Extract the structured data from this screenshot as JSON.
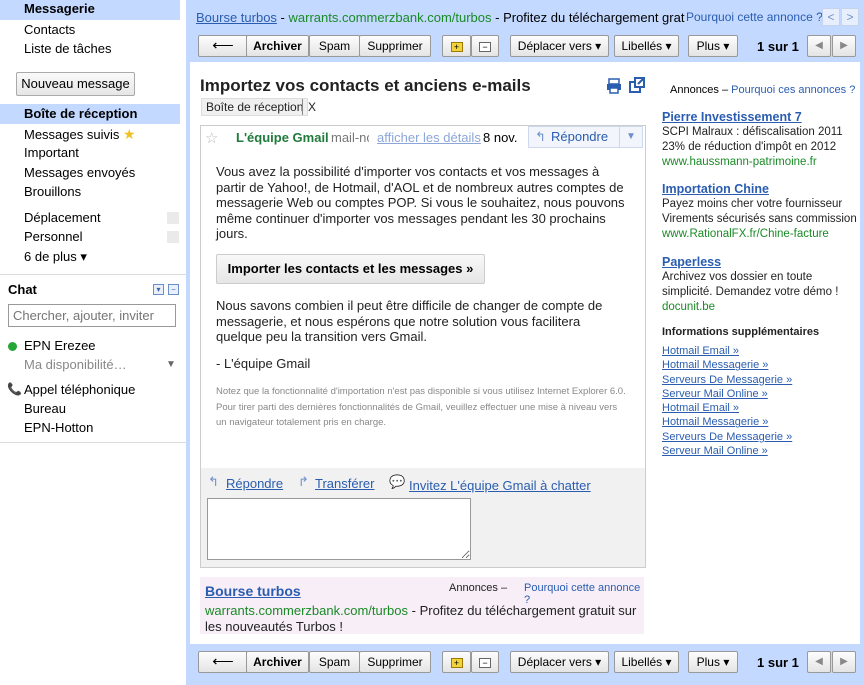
{
  "nav": {
    "mail": "Messagerie",
    "contacts": "Contacts",
    "tasks": "Liste de tâches",
    "compose": "Nouveau message",
    "inbox": "Boîte de réception",
    "starred": "Messages suivis",
    "important": "Important",
    "sent": "Messages envoyés",
    "drafts": "Brouillons",
    "label1": "Déplacement",
    "label2": "Personnel",
    "more": "6 de plus ▾"
  },
  "chat": {
    "title": "Chat",
    "search_placeholder": "Chercher, ajouter, inviter",
    "user": "EPN Erezee",
    "status": "Ma disponibilité…",
    "call": "Appel téléphonique",
    "contact1": "Bureau",
    "contact2": "EPN-Hotton"
  },
  "top_ad": {
    "title": "Bourse turbos",
    "sep": " - ",
    "url": "warrants.commerzbank.com/turbos",
    "text": " - Profitez du téléchargement grat",
    "why": "Pourquoi cette annonce ?"
  },
  "toolbar": {
    "back": "🠐",
    "archive": "Archiver",
    "spam": "Spam",
    "delete": "Supprimer",
    "move": "Déplacer vers ▾",
    "labels": "Libellés ▾",
    "more": "Plus ▾",
    "count": "1 sur 1"
  },
  "message": {
    "subject": "Importez vos contacts et anciens e-mails",
    "label": "Boîte de réception",
    "label_x": "X",
    "sender": "L'équipe Gmail",
    "sender_extra": "mail-noreply",
    "show_details": "afficher les détails",
    "date": "8 nov.",
    "reply": "Répondre",
    "body1": "Vous avez la possibilité d'importer vos contacts et vos messages à partir de Yahoo!, de Hotmail, d'AOL et de nombreux autres comptes de messagerie Web ou comptes POP. Si vous le souhaitez, nous pouvons même continuer d'importer vos messages pendant les 30 prochains jours.",
    "import_button": "Importer les contacts et les messages »",
    "body2": "Nous savons combien il peut être difficile de changer de compte de messagerie, et nous espérons que notre solution vous facilitera quelque peu la transition vers Gmail.",
    "signature": "- L'équipe Gmail",
    "note": "Notez que la fonctionnalité d'importation n'est pas disponible si vous utilisez Internet Explorer 6.0. Pour tirer parti des dernières fonctionnalités de Gmail, veuillez ",
    "note_link": "effectuer une mise à niveau vers un navigateur totalement pris en charge",
    "note_end": "."
  },
  "reply_bar": {
    "reply": "Répondre",
    "forward": "Transférer",
    "invite": "Invitez L'équipe Gmail à chatter"
  },
  "bottom_ad": {
    "title": "Bourse turbos",
    "label": "Annonces –",
    "why": "Pourquoi cette annonce ?",
    "url": "warrants.commerzbank.com/turbos",
    "text": " - Profitez du téléchargement gratuit sur les nouveautés Turbos !"
  },
  "side_ads": {
    "header_label": "Annonces –",
    "header_why": "Pourquoi ces annonces ?",
    "ads": [
      {
        "title": "Pierre Investissement 7",
        "line1": "SCPI Malraux : défiscalisation 2011",
        "line2": "23% de réduction d'impôt en 2012",
        "url": "www.haussmann-patrimoine.fr"
      },
      {
        "title": "Importation Chine",
        "line1": "Payez moins cher votre fournisseur",
        "line2": "Virements sécurisés sans commission",
        "url": "www.RationalFX.fr/Chine-facture"
      },
      {
        "title": "Paperless",
        "line1": "Archivez vos dossier en toute",
        "line2": "simplicité. Demandez votre démo !",
        "url": "docunit.be"
      }
    ],
    "more_info": "Informations supplémentaires",
    "links": [
      "Hotmail Email »",
      "Hotmail Messagerie »",
      "Serveurs De Messagerie »",
      "Serveur Mail Online »",
      "Hotmail Email »",
      "Hotmail Messagerie »",
      "Serveurs De Messagerie »",
      "Serveur Mail Online »"
    ]
  },
  "colors": {
    "nav_highlight": "#c3d9ff",
    "link": "#2a5db0",
    "ad_url": "#1a8a26",
    "sender": "#1f7a3c"
  }
}
